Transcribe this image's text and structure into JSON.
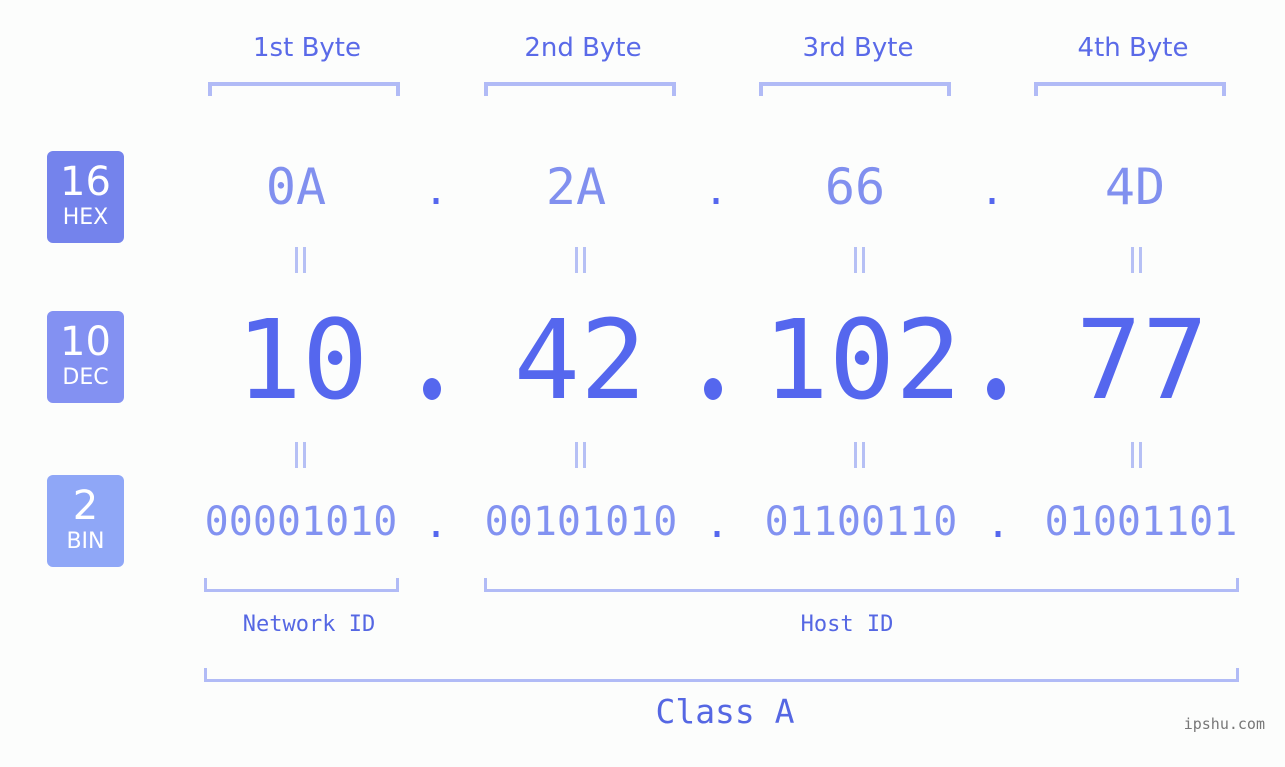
{
  "colors": {
    "background": "#fcfdfc",
    "accent": "#5567ee",
    "hex_badge": "#7483ec",
    "dec_badge": "#8391f2",
    "bin_badge": "#8fa7f7",
    "bracket": "#b1bbf6"
  },
  "bytes": [
    {
      "label": "1st Byte",
      "hex": "0A",
      "dec": "10",
      "bin": "00001010"
    },
    {
      "label": "2nd Byte",
      "hex": "2A",
      "dec": "42",
      "bin": "00101010"
    },
    {
      "label": "3rd Byte",
      "hex": "66",
      "dec": "102",
      "bin": "01100110"
    },
    {
      "label": "4th Byte",
      "hex": "4D",
      "dec": "77",
      "bin": "01001101"
    }
  ],
  "bases": {
    "hex": {
      "num": "16",
      "unit": "HEX"
    },
    "dec": {
      "num": "10",
      "unit": "DEC"
    },
    "bin": {
      "num": "2",
      "unit": "BIN"
    }
  },
  "separator": ".",
  "network_id_label": "Network ID",
  "host_id_label": "Host ID",
  "class_label": "Class A",
  "watermark": "ipshu.com"
}
